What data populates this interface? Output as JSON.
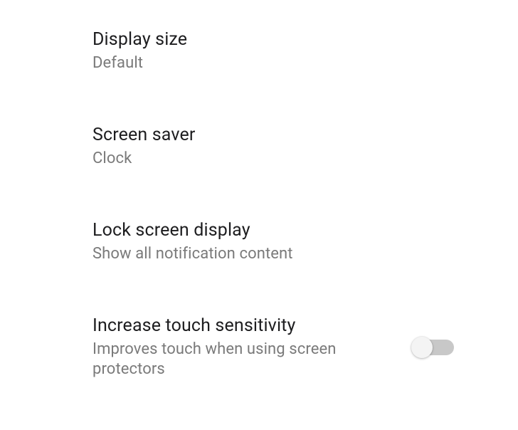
{
  "items": [
    {
      "title": "Display size",
      "subtitle": "Default",
      "hasSwitch": false
    },
    {
      "title": "Screen saver",
      "subtitle": "Clock",
      "hasSwitch": false
    },
    {
      "title": "Lock screen display",
      "subtitle": "Show all notification content",
      "hasSwitch": false
    },
    {
      "title": "Increase touch sensitivity",
      "subtitle": "Improves touch when using screen protectors",
      "hasSwitch": true,
      "switchState": "off"
    }
  ]
}
